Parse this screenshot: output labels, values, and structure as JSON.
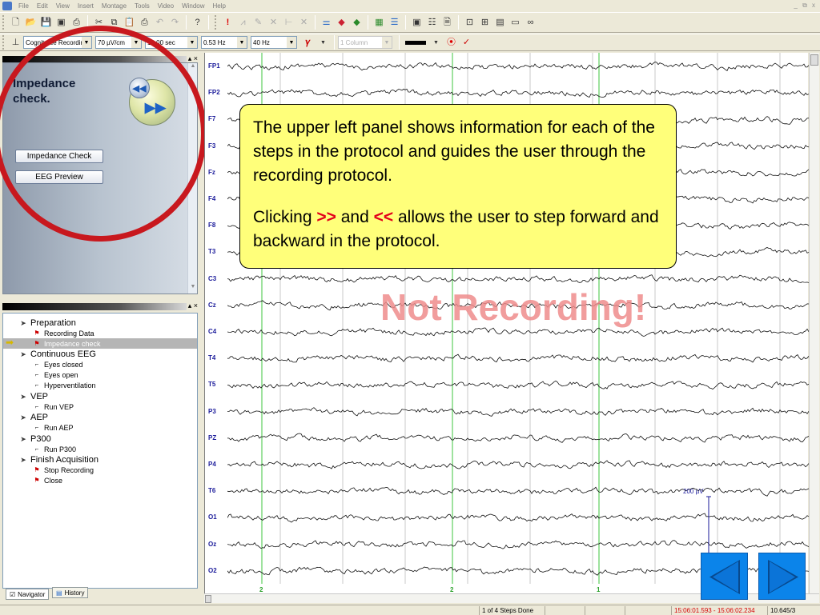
{
  "menu": {
    "items": [
      "File",
      "Edit",
      "View",
      "Insert",
      "Montage",
      "Tools",
      "Video",
      "Window",
      "Help"
    ],
    "window_controls": "_ ⧉ x"
  },
  "toolbar2": {
    "montage": "Cognitrace Recordin",
    "sensitivity": "70 µV/cm",
    "timebase": "10.00 sec",
    "lowcut": "0.53 Hz",
    "highcut": "40 Hz",
    "columns": "1 Column"
  },
  "step_panel": {
    "title": "Impedance check.",
    "buttons": [
      "Impedance Check",
      "EEG Preview"
    ]
  },
  "tree": {
    "items": [
      {
        "label": "Preparation",
        "level": 0,
        "icon": "group-flag-icon"
      },
      {
        "label": "Recording Data",
        "level": 1,
        "icon": "task-done-icon"
      },
      {
        "label": "Impedance check",
        "level": 1,
        "icon": "task-flag-icon",
        "selected": true
      },
      {
        "label": "Continuous EEG",
        "level": 0,
        "icon": "group-icon"
      },
      {
        "label": "Eyes closed",
        "level": 1,
        "icon": "task-icon"
      },
      {
        "label": "Eyes open",
        "level": 1,
        "icon": "task-icon"
      },
      {
        "label": "Hyperventilation",
        "level": 1,
        "icon": "task-icon"
      },
      {
        "label": "VEP",
        "level": 0,
        "icon": "group-icon"
      },
      {
        "label": "Run VEP",
        "level": 1,
        "icon": "task-icon"
      },
      {
        "label": "AEP",
        "level": 0,
        "icon": "group-icon"
      },
      {
        "label": "Run AEP",
        "level": 1,
        "icon": "task-icon"
      },
      {
        "label": "P300",
        "level": 0,
        "icon": "group-icon"
      },
      {
        "label": "Run P300",
        "level": 1,
        "icon": "task-icon"
      },
      {
        "label": "Finish Acquisition",
        "level": 0,
        "icon": "group-flag-icon"
      },
      {
        "label": "Stop Recording",
        "level": 1,
        "icon": "task-flag-icon"
      },
      {
        "label": "Close",
        "level": 1,
        "icon": "task-flag-icon"
      }
    ],
    "tabs": [
      "Navigator",
      "History"
    ]
  },
  "eeg": {
    "channels": [
      "FP1",
      "FP2",
      "F7",
      "F3",
      "Fz",
      "F4",
      "F8",
      "T3",
      "C3",
      "Cz",
      "C4",
      "T4",
      "T5",
      "P3",
      "PZ",
      "P4",
      "T6",
      "O1",
      "Oz",
      "O2"
    ],
    "markers": [
      "2",
      "2",
      "1"
    ],
    "watermark": "Not Recording!",
    "scale_label": "200 µV"
  },
  "callout": {
    "line1": "The upper left panel shows information for each of the steps in the protocol and guides the user through the recording protocol.",
    "line2_pre": "Clicking ",
    "forward_symbol": ">>",
    "line2_mid": " and ",
    "back_symbol": "<<",
    "line2_post": " allows the user to step forward and backward in the protocol."
  },
  "status": {
    "steps": "1 of 4 Steps Done",
    "time_range": "15:06:01.593 - 15:06:02.234",
    "position": "10.645/3"
  },
  "colors": {
    "accent_blue": "#0b84ea",
    "ellipse_red": "#c8181e",
    "callout_yellow": "#ffff7a",
    "watermark_pink": "#ef8c8c",
    "time_red": "#d40000"
  }
}
